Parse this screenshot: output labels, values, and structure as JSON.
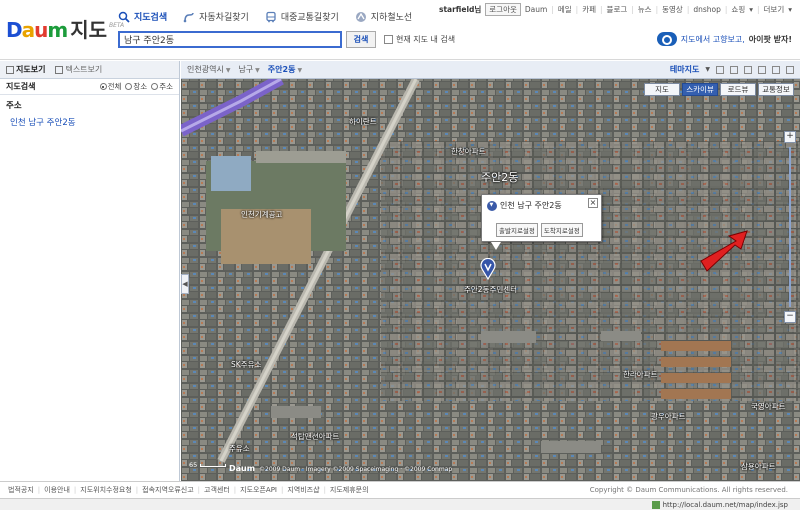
{
  "logo": {
    "brand": "Daum",
    "service": "지도",
    "beta": "BETA"
  },
  "nav": [
    {
      "label": "지도검색",
      "icon": "search-icon"
    },
    {
      "label": "자동차길찾기",
      "icon": "car-route-icon"
    },
    {
      "label": "대중교통길찾기",
      "icon": "bus-icon"
    },
    {
      "label": "지하철노선",
      "icon": "subway-icon"
    }
  ],
  "search": {
    "value": "남구 주안2동",
    "button": "검색",
    "option": "현재 지도 내 검색"
  },
  "util": {
    "user": "starfield님",
    "logout": "로그아웃",
    "links": [
      "Daum",
      "메일",
      "카페",
      "블로그",
      "뉴스",
      "동영상",
      "dnshop",
      "쇼핑",
      "더보기"
    ]
  },
  "promo": {
    "text": "지도에서 고향보고,",
    "strong": "아이팟 받자!"
  },
  "sidebar": {
    "tabs": [
      "지도보기",
      "텍스트보기"
    ],
    "search_title": "지도검색",
    "radios": [
      "전체",
      "장소",
      "주소"
    ],
    "section": "주소",
    "result": "인천 남구 주안2동"
  },
  "map": {
    "breadcrumb": [
      "인천광역시",
      "남구",
      "주안2동"
    ],
    "theme": "테마지도",
    "view_tabs": [
      "지도",
      "스카이뷰",
      "로드뷰",
      "교통정보"
    ],
    "popup": {
      "title": "인천 남구 주안2동",
      "btn_start": "출발지로설정",
      "btn_end": "도착지로설정"
    },
    "labels": [
      {
        "text": "주안2동",
        "big": true
      },
      {
        "text": "인천기계공고",
        "big": false
      },
      {
        "text": "주안2동주민센터",
        "big": false
      },
      {
        "text": "한라아파트",
        "big": false
      },
      {
        "text": "광우아파트",
        "big": false
      },
      {
        "text": "석탑맨션아파트",
        "big": false
      },
      {
        "text": "삼용아파트",
        "big": false
      },
      {
        "text": "SK주유소",
        "big": false
      },
      {
        "text": "주유소",
        "big": false
      },
      {
        "text": "하이란트",
        "big": false
      },
      {
        "text": "한창아파트",
        "big": false
      },
      {
        "text": "국영아파트",
        "big": false
      }
    ],
    "scale": "65",
    "copyright": "©2009 Daum · Imagery ©2009 Spaceimaging · ©2009 Conmap"
  },
  "footer": {
    "links": [
      "법적공지",
      "이용안내",
      "지도위치수정요청",
      "접속지역오류신고",
      "고객센터",
      "지도오픈API",
      "지역비즈샵",
      "지도제휴문의"
    ],
    "copyright": "Copyright © Daum Communications. All rights reserved."
  },
  "status": {
    "url": "http://local.daum.net/map/index.jsp"
  }
}
